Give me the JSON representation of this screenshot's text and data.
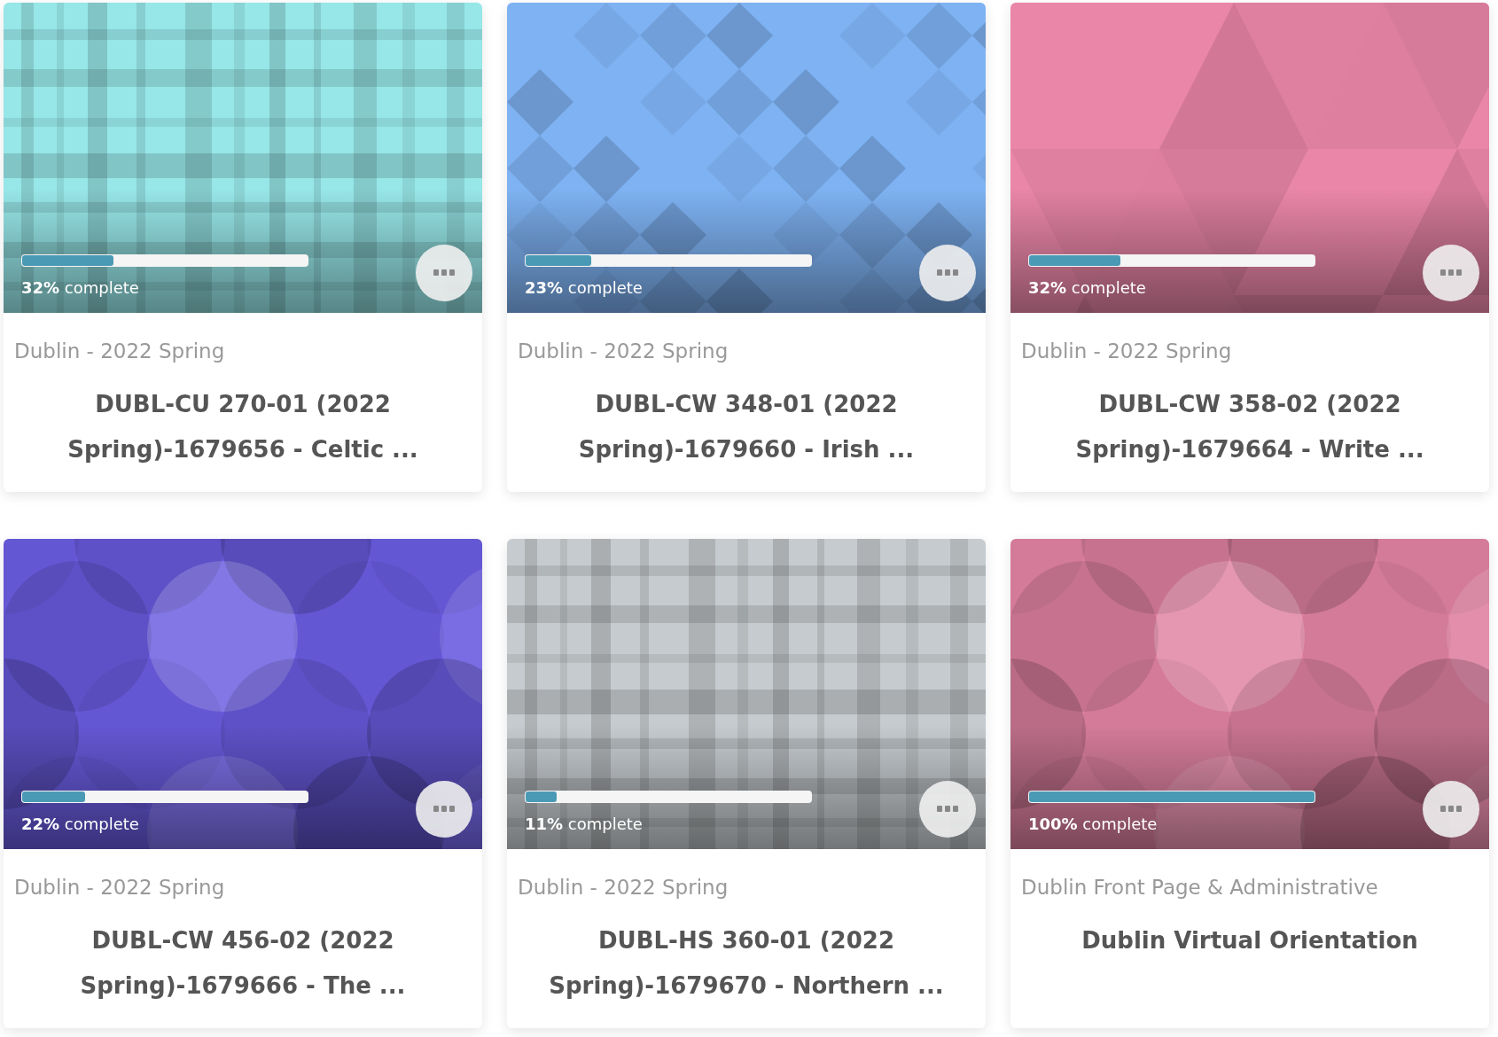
{
  "courses": [
    {
      "kind": "plaid",
      "color": "#97e6e8",
      "level": 0.32,
      "progress": "**32%** complete",
      "term": "Dublin - 2022 Spring",
      "title": "DUBL-CU 270-01 (2022 Spring)-1679656 - Celtic ..."
    },
    {
      "kind": "diamonds",
      "color": "#7eb2f2",
      "level": 0.23,
      "progress": "**23%** complete",
      "term": "Dublin - 2022 Spring",
      "title": "DUBL-CW 348-01 (2022 Spring)-1679660 - Irish ..."
    },
    {
      "kind": "triangles",
      "color": "#ea86a8",
      "level": 0.32,
      "progress": "**32%** complete",
      "term": "Dublin - 2022 Spring",
      "title": "DUBL-CW 358-02 (2022 Spring)-1679664 - Write ..."
    },
    {
      "kind": "circles",
      "color": "#6a5ce0",
      "level": 0.22,
      "progress": "**22%** complete",
      "term": "Dublin - 2022 Spring",
      "title": "DUBL-CW 456-02 (2022 Spring)-1679666 - The ..."
    },
    {
      "kind": "plaid",
      "color": "#c6cbcf",
      "level": 0.11,
      "progress": "**11%** complete",
      "term": "Dublin - 2022 Spring",
      "title": "DUBL-HS 360-01 (2022 Spring)-1679670 - Northern ..."
    },
    {
      "kind": "circles",
      "color": "#e082a2",
      "level": 1,
      "progress": "**100%** complete",
      "term": "Dublin Front Page & Administrative",
      "title": "Dublin Virtual Orientation"
    }
  ]
}
